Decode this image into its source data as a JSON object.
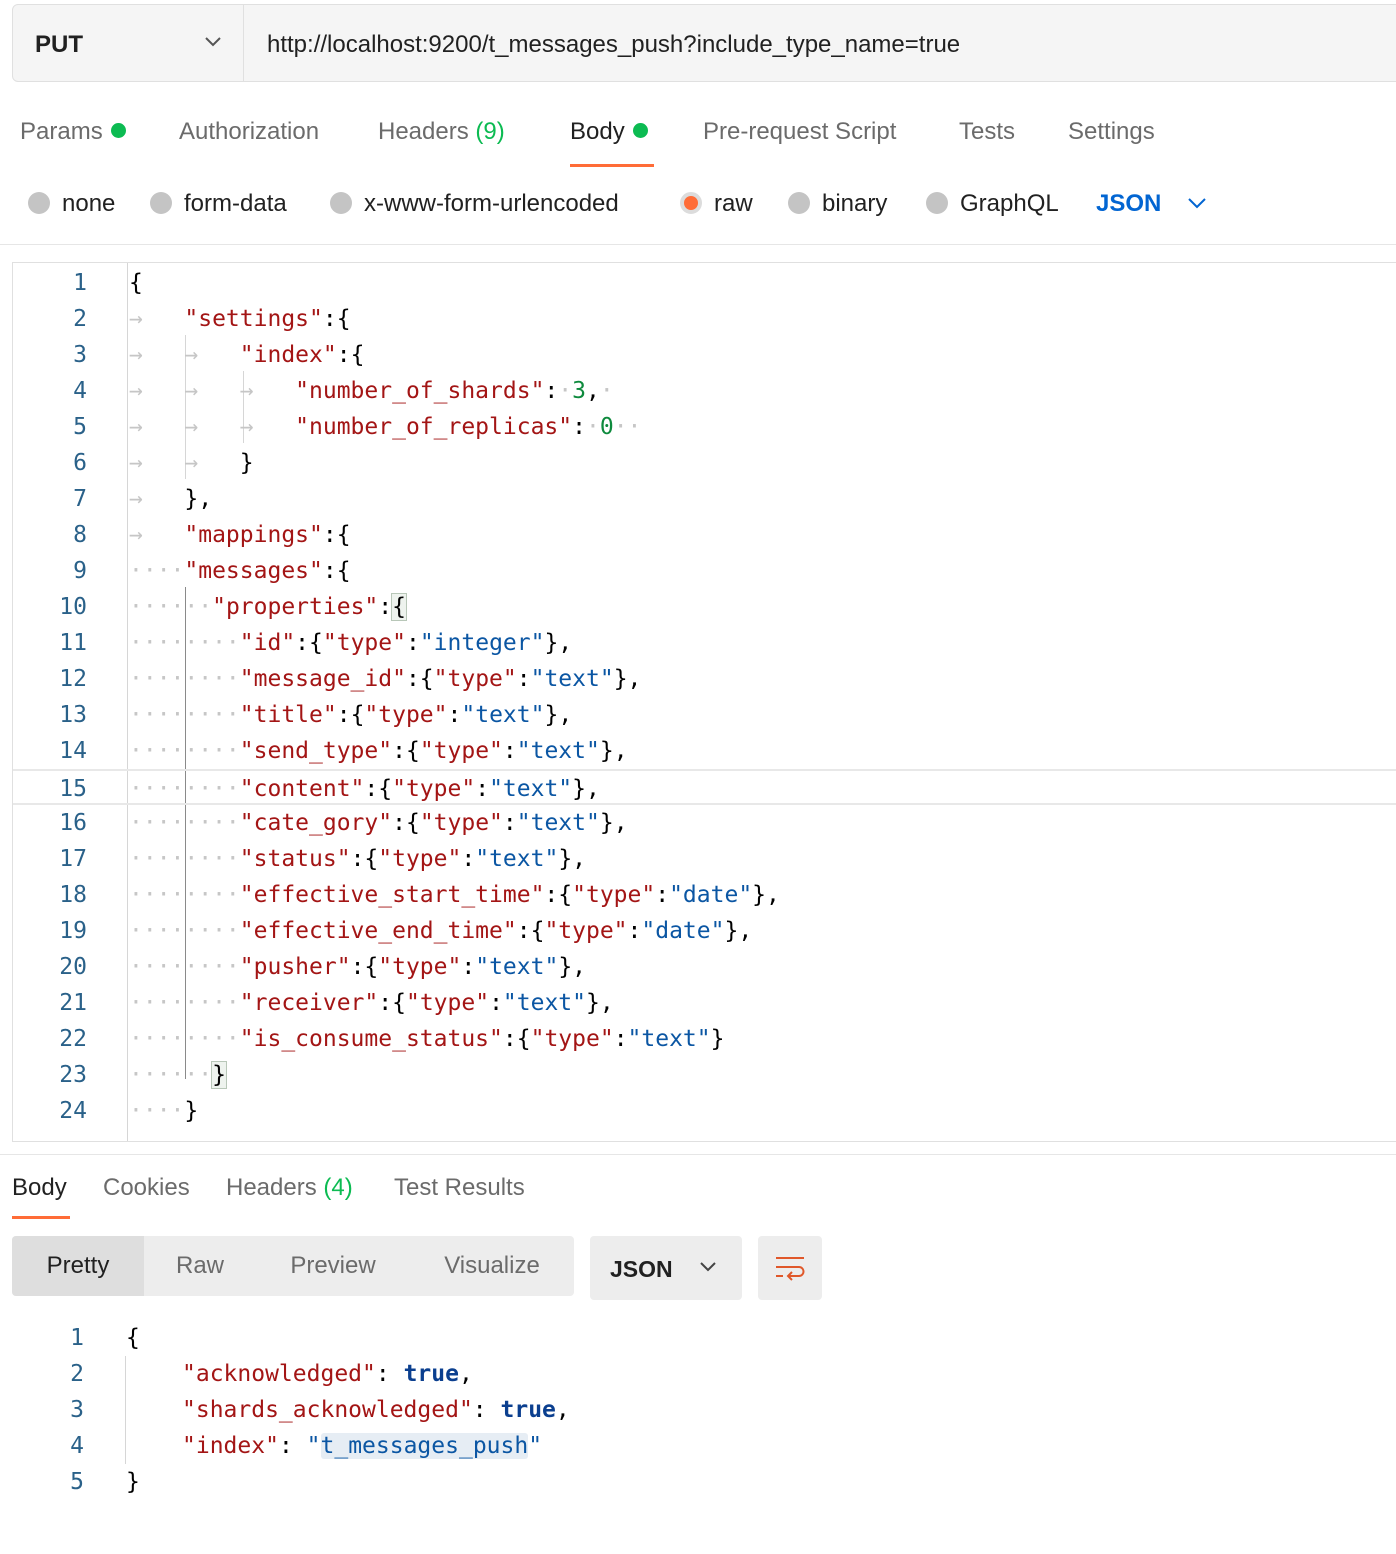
{
  "request": {
    "method": "PUT",
    "url": "http://localhost:9200/t_messages_push?include_type_name=true",
    "tabs": [
      {
        "label": "Params"
      },
      {
        "label": "Authorization"
      },
      {
        "label": "Headers",
        "count": "(9)"
      },
      {
        "label": "Body"
      },
      {
        "label": "Pre-request Script"
      },
      {
        "label": "Tests"
      },
      {
        "label": "Settings"
      }
    ],
    "active_tab": "Body",
    "body_types": [
      "none",
      "form-data",
      "x-www-form-urlencoded",
      "raw",
      "binary",
      "GraphQL"
    ],
    "selected_body_type": "raw",
    "format": "JSON",
    "line_numbers": [
      "1",
      "2",
      "3",
      "4",
      "5",
      "6",
      "7",
      "8",
      "9",
      "10",
      "11",
      "12",
      "13",
      "14",
      "15",
      "16",
      "17",
      "18",
      "19",
      "20",
      "21",
      "22",
      "23",
      "24"
    ],
    "code": {
      "settings_key": "\"settings\"",
      "index_key": "\"index\"",
      "shards_key": "\"number_of_shards\"",
      "shards_val": "3",
      "replicas_key": "\"number_of_replicas\"",
      "replicas_val": "0",
      "mappings_key": "\"mappings\"",
      "messages_key": "\"messages\"",
      "properties_key": "\"properties\"",
      "type_key": "\"type\"",
      "fields": [
        {
          "name": "\"id\"",
          "type": "\"integer\""
        },
        {
          "name": "\"message_id\"",
          "type": "\"text\""
        },
        {
          "name": "\"title\"",
          "type": "\"text\""
        },
        {
          "name": "\"send_type\"",
          "type": "\"text\""
        },
        {
          "name": "\"content\"",
          "type": "\"text\""
        },
        {
          "name": "\"cate_gory\"",
          "type": "\"text\""
        },
        {
          "name": "\"status\"",
          "type": "\"text\""
        },
        {
          "name": "\"effective_start_time\"",
          "type": "\"date\""
        },
        {
          "name": "\"effective_end_time\"",
          "type": "\"date\""
        },
        {
          "name": "\"pusher\"",
          "type": "\"text\""
        },
        {
          "name": "\"receiver\"",
          "type": "\"text\""
        },
        {
          "name": "\"is_consume_status\"",
          "type": "\"text\""
        }
      ]
    }
  },
  "response": {
    "tabs": [
      {
        "label": "Body"
      },
      {
        "label": "Cookies"
      },
      {
        "label": "Headers",
        "count": "(4)"
      },
      {
        "label": "Test Results"
      }
    ],
    "view_modes": [
      "Pretty",
      "Raw",
      "Preview",
      "Visualize"
    ],
    "format": "JSON",
    "line_numbers": [
      "1",
      "2",
      "3",
      "4",
      "5"
    ],
    "acknowledged_key": "\"acknowledged\"",
    "acknowledged_val": "true",
    "shards_key": "\"shards_acknowledged\"",
    "shards_val": "true",
    "index_key": "\"index\"",
    "index_val_q1": "\"",
    "index_val": "t_messages_push",
    "index_val_q2": "\""
  },
  "icons": {
    "method_dropdown": "chevron-down-icon",
    "format_dropdown": "chevron-down-icon",
    "wrap": "wrap-lines-icon"
  },
  "colors": {
    "accent": "#ff6c37",
    "status_dot": "#0cbb52",
    "link": "#0265d2",
    "json_key": "#a31515",
    "json_string": "#0b56a3",
    "json_number": "#0e8a3d"
  }
}
